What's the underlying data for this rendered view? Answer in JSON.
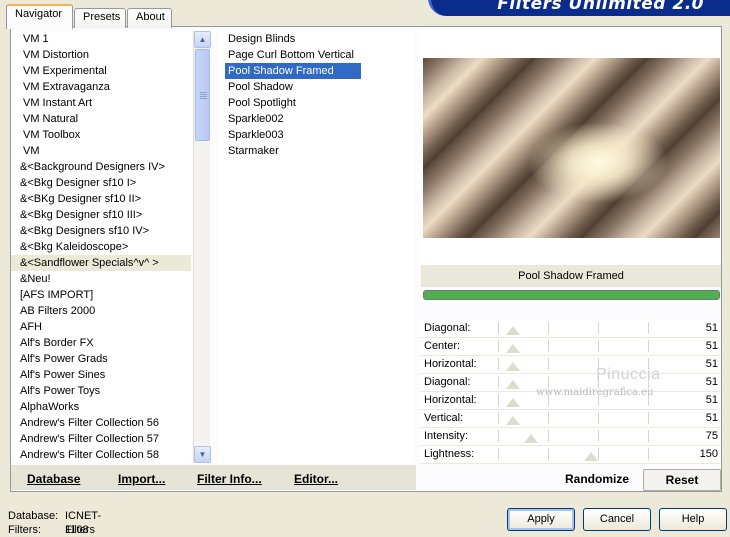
{
  "tabs": [
    {
      "label": "Navigator",
      "active": true
    },
    {
      "label": "Presets",
      "active": false
    },
    {
      "label": "About",
      "active": false
    }
  ],
  "header": {
    "title": "Filters Unlimited 2.0"
  },
  "categories": [
    "VM 1",
    "VM Distortion",
    "VM Experimental",
    "VM Extravaganza",
    "VM Instant Art",
    "VM Natural",
    "VM Toolbox",
    "VM",
    "&<Background Designers IV>",
    "&<Bkg Designer sf10 I>",
    "&<BKg Designer sf10 II>",
    "&<Bkg Designer sf10 III>",
    "&<Bkg Designers sf10 IV>",
    "&<Bkg Kaleidoscope>",
    "&<Sandflower Specials^v^ >",
    "&Neu!",
    "[AFS IMPORT]",
    "AB Filters 2000",
    "AFH",
    "Alf's Border FX",
    "Alf's Power Grads",
    "Alf's Power Sines",
    "Alf's Power Toys",
    "AlphaWorks",
    "Andrew's Filter Collection 56",
    "Andrew's Filter Collection 57",
    "Andrew's Filter Collection 58"
  ],
  "filters": [
    "Design Blinds",
    "Page Curl Bottom Vertical",
    "Pool Shadow Framed",
    "Pool Shadow",
    "Pool Spotlight",
    "Sparkle002",
    "Sparkle003",
    "Starmaker"
  ],
  "preview": {
    "filter_name": "Pool Shadow Framed",
    "progress": 1.0
  },
  "params": [
    {
      "label": "Diagonal:",
      "value": "51",
      "fraction": 0.2
    },
    {
      "label": "Center:",
      "value": "51",
      "fraction": 0.2
    },
    {
      "label": "Horizontal:",
      "value": "51",
      "fraction": 0.2
    },
    {
      "label": "Diagonal:",
      "value": "51",
      "fraction": 0.2
    },
    {
      "label": "Horizontal:",
      "value": "51",
      "fraction": 0.2
    },
    {
      "label": "Vertical:",
      "value": "51",
      "fraction": 0.2
    },
    {
      "label": "Intensity:",
      "value": "75",
      "fraction": 0.29
    },
    {
      "label": "Lightness:",
      "value": "150",
      "fraction": 0.59
    }
  ],
  "watermark": {
    "name": "Pinuccia",
    "site": "www.maidiregrafica.eu"
  },
  "toolbar": {
    "database": "Database",
    "import": "Import...",
    "filter_info": "Filter Info...",
    "editor": "Editor...",
    "randomize": "Randomize",
    "reset": "Reset"
  },
  "status": {
    "database_label": "Database:",
    "database_value": "ICNET-Filters",
    "filters_label": "Filters:",
    "filters_value": "1108"
  },
  "buttons": {
    "apply": "Apply",
    "cancel": "Cancel",
    "help": "Help"
  },
  "colors": {
    "selection": "#316ac5",
    "banner": "#0a2c8c",
    "progress": "#4fb04f"
  }
}
